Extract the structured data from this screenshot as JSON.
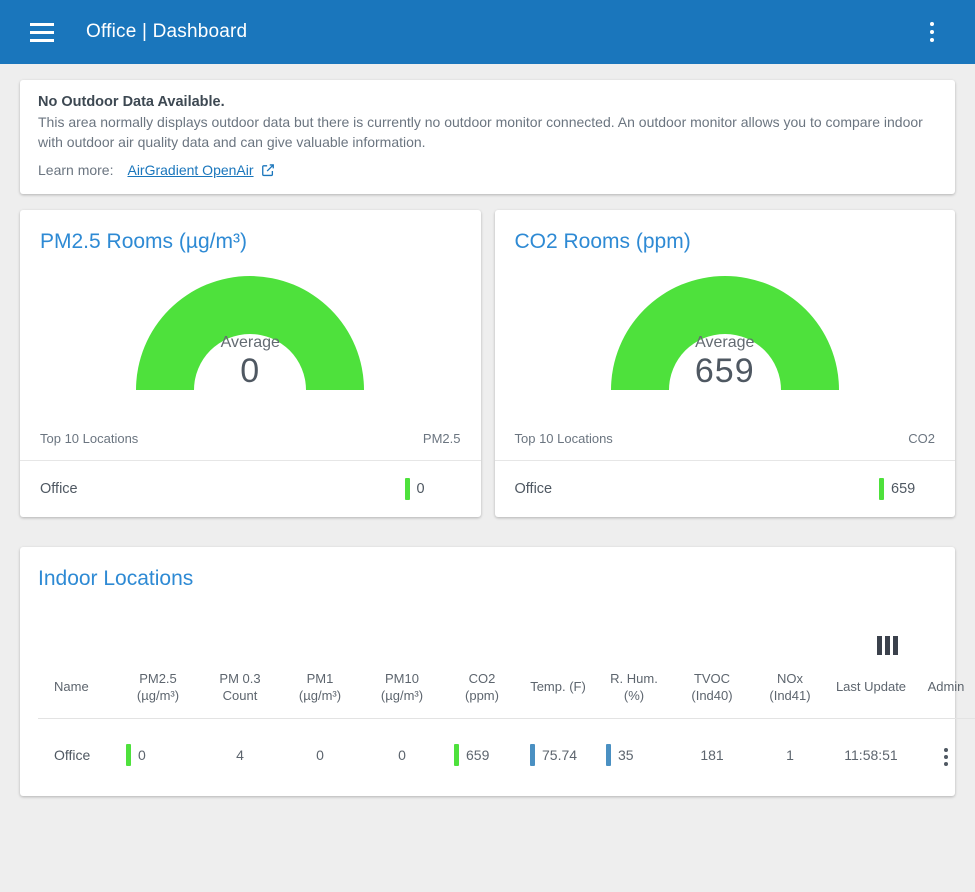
{
  "header": {
    "title": "Office | Dashboard",
    "menu_icon": "hamburger-icon",
    "overflow_icon": "kebab-menu-icon",
    "bg_color": "#1a76bc"
  },
  "notice": {
    "title": "No Outdoor Data Available.",
    "body": "This area normally displays outdoor data but there is currently no outdoor monitor connected. An outdoor monitor allows you to compare indoor with outdoor air quality data and can give valuable information.",
    "learn_more_label": "Learn more:",
    "link_label": "AirGradient OpenAir",
    "link_icon": "external-link-icon"
  },
  "gauges": [
    {
      "title": "PM2.5 Rooms (µg/m³)",
      "average_label": "Average",
      "average_value": "0",
      "gauge_color": "#4ee13c",
      "list_header_left": "Top 10 Locations",
      "list_header_right": "PM2.5",
      "rows": [
        {
          "name": "Office",
          "value": "0",
          "bar_color": "#4ee13c"
        }
      ]
    },
    {
      "title": "CO2 Rooms (ppm)",
      "average_label": "Average",
      "average_value": "659",
      "gauge_color": "#4ee13c",
      "list_header_left": "Top 10 Locations",
      "list_header_right": "CO2",
      "rows": [
        {
          "name": "Office",
          "value": "659",
          "bar_color": "#4ee13c"
        }
      ]
    }
  ],
  "locations": {
    "title": "Indoor Locations",
    "columns_icon": "columns-toggle-icon",
    "columns": [
      "Name",
      "PM2.5 (µg/m³)",
      "PM 0.3 Count",
      "PM1 (µg/m³)",
      "PM10 (µg/m³)",
      "CO2 (ppm)",
      "Temp. (F)",
      "R. Hum. (%)",
      "TVOC (Ind40)",
      "NOx (Ind41)",
      "Last Update",
      "Admin"
    ],
    "rows": [
      {
        "name": "Office",
        "pm25": "0",
        "pm03_count": "4",
        "pm1": "0",
        "pm10": "0",
        "co2": "659",
        "temp_f": "75.74",
        "humidity": "35",
        "tvoc": "181",
        "nox": "1",
        "last_update": "11:58:51",
        "admin_icon": "kebab-menu-icon",
        "pm25_bar_color": "#4ee13c",
        "co2_bar_color": "#4ee13c",
        "temp_bar_color": "#4a90c2",
        "humidity_bar_color": "#4a90c2"
      }
    ]
  }
}
